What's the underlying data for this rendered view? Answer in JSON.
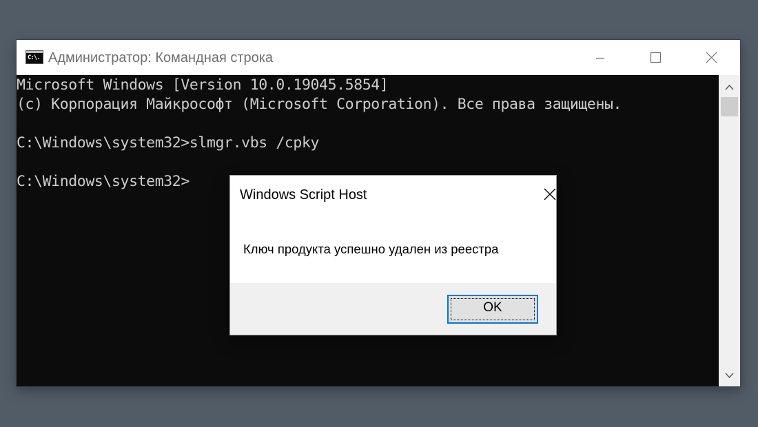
{
  "window": {
    "title": "Администратор: Командная строка",
    "icon_text": "C:\\."
  },
  "console": {
    "lines": [
      "Microsoft Windows [Version 10.0.19045.5854]",
      "(c) Корпорация Майкрософт (Microsoft Corporation). Все права защищены.",
      "",
      "C:\\Windows\\system32>slmgr.vbs /cpky",
      "",
      "C:\\Windows\\system32>"
    ]
  },
  "dialog": {
    "title": "Windows Script Host",
    "message": "Ключ продукта успешно удален из реестра",
    "ok_label": "OK"
  },
  "icons": {
    "app": "cmd-icon",
    "minimize": "minimize-icon",
    "maximize": "maximize-icon",
    "close": "close-icon",
    "scroll_up": "chevron-up-icon",
    "scroll_down": "chevron-down-icon"
  },
  "colors": {
    "console_bg": "#0c0c0c",
    "console_text": "#cccccc",
    "desktop_bg": "#525c67",
    "button_border": "#0078d7"
  }
}
